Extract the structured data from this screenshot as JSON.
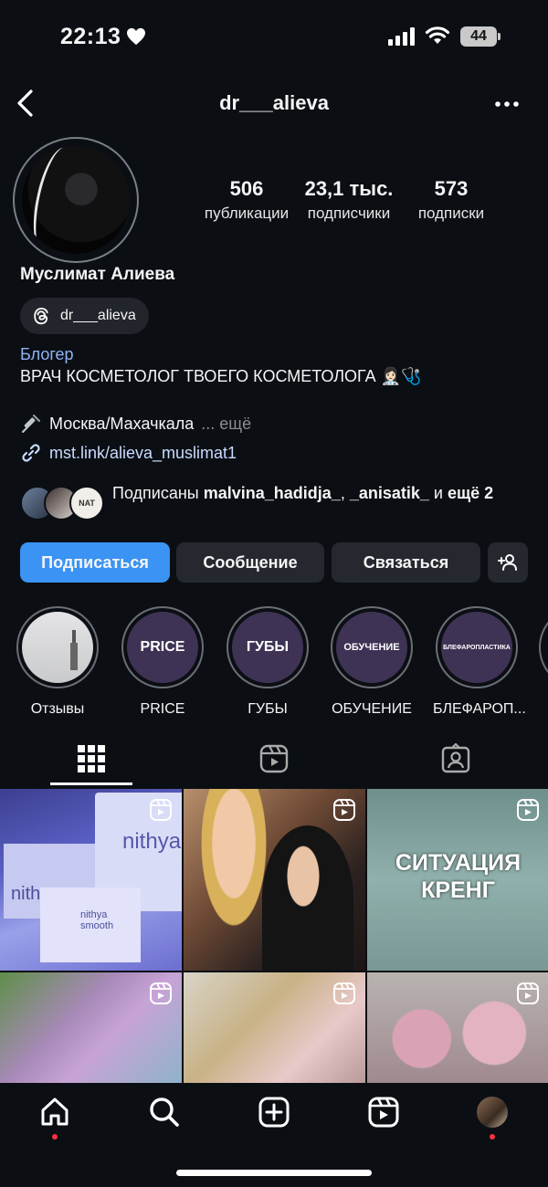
{
  "status_bar": {
    "time": "22:13",
    "battery": "44"
  },
  "header": {
    "username": "dr___alieva"
  },
  "stats": [
    {
      "value": "506",
      "label": "публикации"
    },
    {
      "value": "23,1 тыс.",
      "label": "подписчики"
    },
    {
      "value": "573",
      "label": "подписки"
    }
  ],
  "profile": {
    "full_name": "Муслимат Алиева",
    "threads_handle": "dr___alieva",
    "category": "Блогер",
    "bio": "ВРАЧ КОСМЕТОЛОГ ТВОЕГО КОСМЕТОЛОГА 👩🏻‍⚕️🩺",
    "location": "Москва/Махачкала",
    "location_more": "... ещё",
    "link": "mst.link/alieva_muslimat1",
    "followed_prefix": "Подписаны ",
    "followed_user1": "malvina_hadidja_",
    "followed_sep": ", ",
    "followed_user2": "_anisatik_",
    "followed_and": " и ",
    "followed_more": "ещё 2",
    "follower_avatar_text": "NAT"
  },
  "buttons": {
    "follow": "Подписаться",
    "message": "Сообщение",
    "contact": "Связаться"
  },
  "highlights": [
    {
      "inner": "",
      "caption": "Отзывы"
    },
    {
      "inner": "PRICE",
      "caption": "PRICE"
    },
    {
      "inner": "ГУБЫ",
      "caption": "ГУБЫ"
    },
    {
      "inner": "ОБУЧЕНИЕ",
      "caption": "ОБУЧЕНИЕ"
    },
    {
      "inner": "БЛЕФАРОПЛАСТИКА",
      "caption": "БЛЕФАРОП..."
    }
  ],
  "grid": {
    "tile1_brand": "nithya",
    "tile1_brand2": "nithya smooth",
    "tile3_text": "СИТУАЦИЯ КРЕНГ"
  },
  "colors": {
    "primary": "#3b93f3",
    "highlight_bg": "#3e3354",
    "notification": "#ff3040"
  }
}
